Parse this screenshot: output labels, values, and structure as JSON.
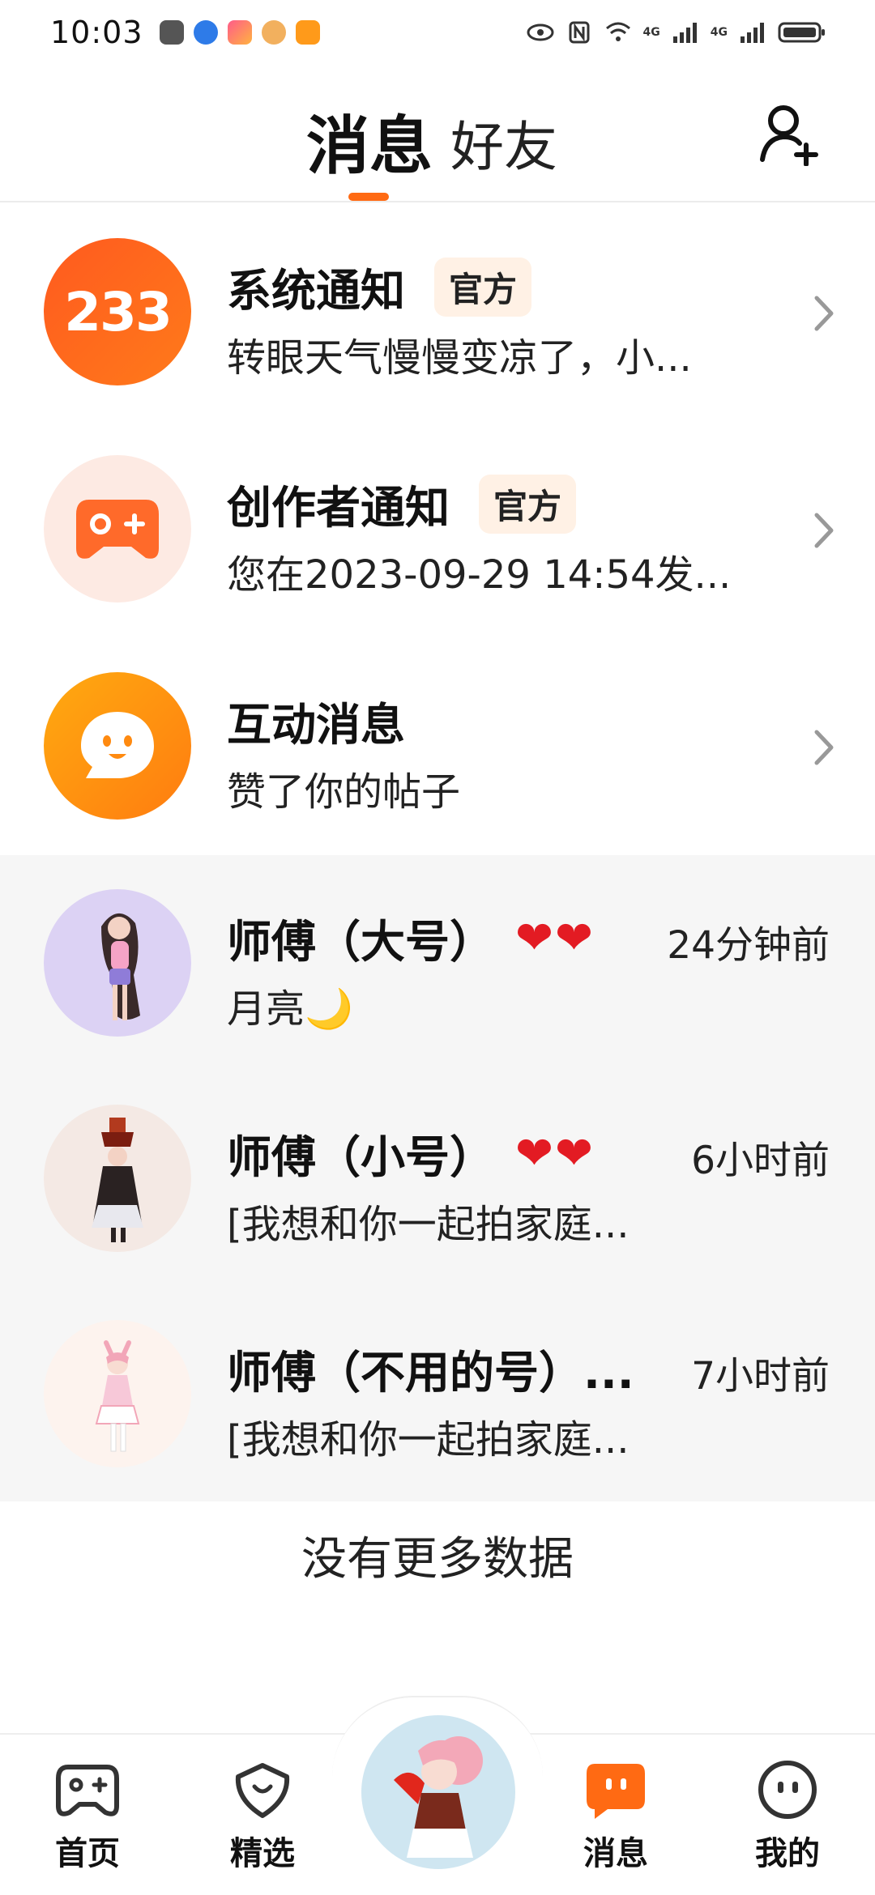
{
  "status_bar": {
    "time": "10:03",
    "network_label_1": "4G",
    "network_label_2": "4G"
  },
  "header": {
    "tab_messages": "消息",
    "tab_friends": "好友"
  },
  "notifications": [
    {
      "title": "系统通知",
      "badge": "官方",
      "subtitle": "转眼天气慢慢变凉了，小..."
    },
    {
      "title": "创作者通知",
      "badge": "官方",
      "subtitle": "您在2023-09-29 14:54发..."
    },
    {
      "title": "互动消息",
      "subtitle": "赞了你的帖子"
    }
  ],
  "system_avatar_text": "233",
  "chats": [
    {
      "name": "师傅（大号）",
      "hearts": "❤❤",
      "time": "24分钟前",
      "message": "月亮🌙"
    },
    {
      "name": "师傅（小号）",
      "hearts": "❤❤",
      "time": "6小时前",
      "message": "[我想和你一起拍家庭..."
    },
    {
      "name": "师傅（不用的号）...",
      "time": "7小时前",
      "message": "[我想和你一起拍家庭..."
    }
  ],
  "footer_text": "没有更多数据",
  "nav": {
    "home": "首页",
    "featured": "精选",
    "messages": "消息",
    "mine": "我的"
  },
  "colors": {
    "accent": "#ff6a13",
    "badge_bg": "#fff1e5",
    "chat_bg": "#f6f6f6"
  }
}
